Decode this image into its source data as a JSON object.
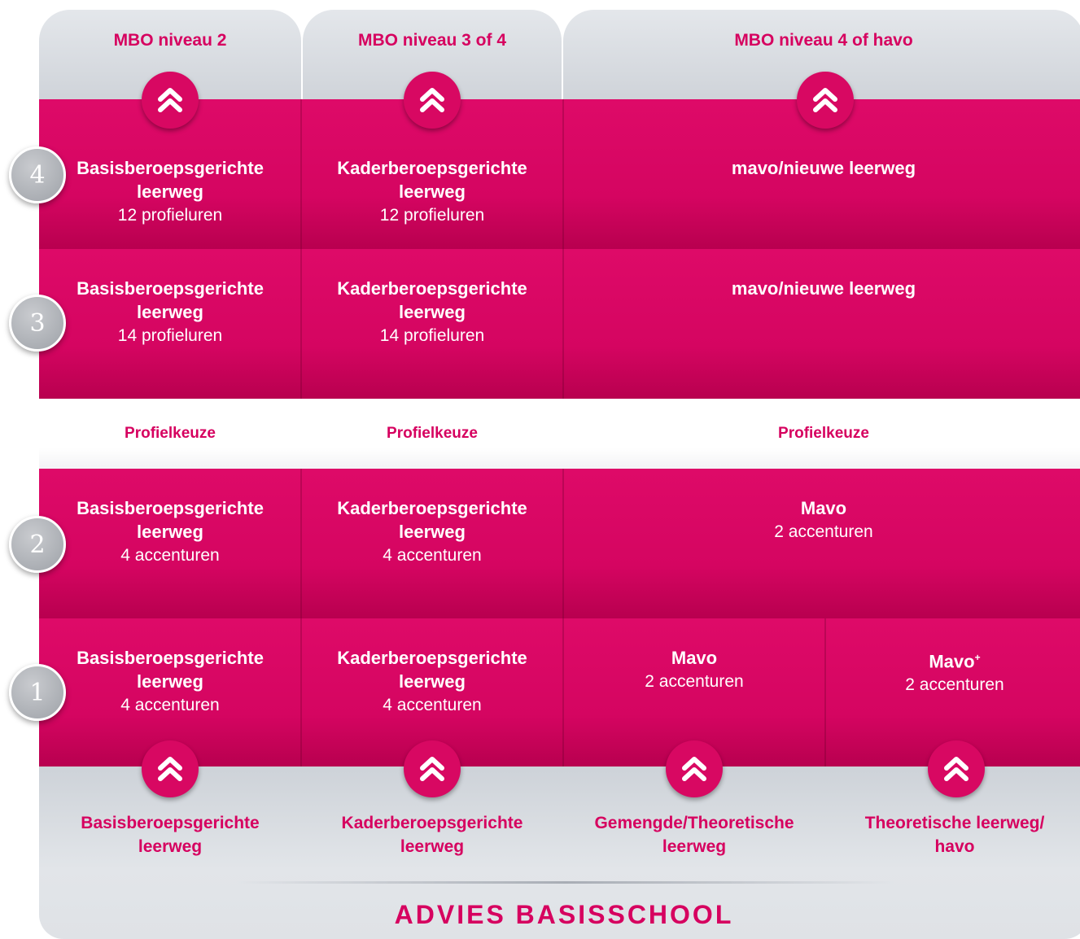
{
  "colors": {
    "accent": "#d6005f",
    "grey": "#d5d9de"
  },
  "top_headers": [
    "MBO niveau 2",
    "MBO niveau 3 of 4",
    "MBO niveau 4 of havo"
  ],
  "rows": {
    "year4": {
      "number": "4",
      "cells": [
        {
          "title1": "Basisberoepsgerichte",
          "title2": "leerweg",
          "sub": "12 profieluren"
        },
        {
          "title1": "Kaderberoepsgerichte",
          "title2": "leerweg",
          "sub": "12 profieluren"
        },
        {
          "title1": "mavo/nieuwe leerweg"
        }
      ]
    },
    "year3": {
      "number": "3",
      "cells": [
        {
          "title1": "Basisberoepsgerichte",
          "title2": "leerweg",
          "sub": "14 profieluren"
        },
        {
          "title1": "Kaderberoepsgerichte",
          "title2": "leerweg",
          "sub": "14 profieluren"
        },
        {
          "title1": "mavo/nieuwe leerweg"
        }
      ]
    },
    "profielkeuze": [
      "Profielkeuze",
      "Profielkeuze",
      "Profielkeuze"
    ],
    "year2": {
      "number": "2",
      "cells": [
        {
          "title1": "Basisberoepsgerichte",
          "title2": "leerweg",
          "sub": "4 accenturen"
        },
        {
          "title1": "Kaderberoepsgerichte",
          "title2": "leerweg",
          "sub": "4 accenturen"
        },
        {
          "title1": "Mavo",
          "sub": "2 accenturen"
        }
      ]
    },
    "year1": {
      "number": "1",
      "cells": [
        {
          "title1": "Basisberoepsgerichte",
          "title2": "leerweg",
          "sub": "4 accenturen"
        },
        {
          "title1": "Kaderberoepsgerichte",
          "title2": "leerweg",
          "sub": "4 accenturen"
        },
        {
          "title1": "Mavo",
          "sub": "2 accenturen"
        },
        {
          "title1": "Mavo",
          "sup": "+",
          "sub": "2 accenturen"
        }
      ]
    }
  },
  "bottom_labels": [
    {
      "line1": "Basisberoepsgerichte",
      "line2": "leerweg"
    },
    {
      "line1": "Kaderberoepsgerichte",
      "line2": "leerweg"
    },
    {
      "line1": "Gemengde/Theoretische",
      "line2": "leerweg"
    },
    {
      "line1": "Theoretische leerweg/",
      "line2": "havo"
    }
  ],
  "footer": "ADVIES BASISSCHOOL",
  "icons": {
    "chevron": "double-chevron-up-icon"
  }
}
